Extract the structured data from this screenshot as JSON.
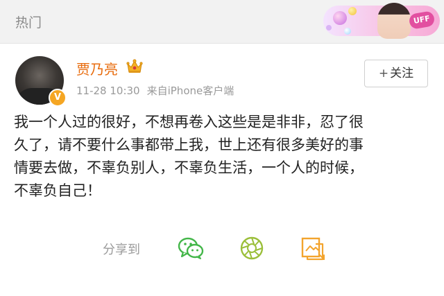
{
  "header": {
    "title": "热门",
    "banner_badge": "UFF"
  },
  "post": {
    "author": "贾乃亮",
    "verified_badge": "V",
    "time": "11-28 10:30",
    "source": "来自iPhone客户端",
    "follow_plus": "+",
    "follow_label": "关注",
    "lines": [
      "我一个人过的很好，不想再卷入这些是是非非，忍了很",
      "久了，请不要什么事都带上我，世上还有很多美好的事",
      "情要去做，不辜负别人，不辜负生活，一个人的时候，",
      "不辜负自己！"
    ]
  },
  "share": {
    "label": "分享到",
    "icons": [
      "wechat-icon",
      "moments-icon",
      "qzone-icon"
    ]
  },
  "colors": {
    "author": "#e86b0c",
    "wechat": "#43b649",
    "moments": "#9bbf3a",
    "qzone": "#f3a42d"
  }
}
